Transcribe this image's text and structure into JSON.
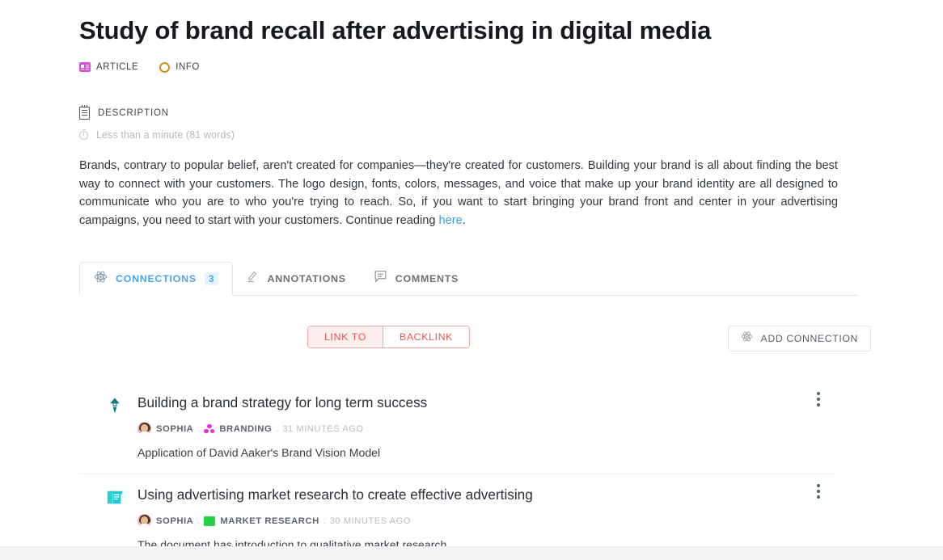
{
  "document": {
    "title": "Study of brand recall after advertising in digital media",
    "badges": [
      {
        "label": "ARTICLE",
        "icon": "article-icon",
        "color": "#d94fd9"
      },
      {
        "label": "INFO",
        "icon": "info-circle-icon",
        "color": "#c8920f"
      }
    ]
  },
  "description": {
    "heading": "DESCRIPTION",
    "heading_icon": "notepad-icon",
    "meta_icon": "clock-icon",
    "meta": "Less than a minute (81 words)",
    "body_before_link": "Brands, contrary to popular belief, aren't created for companies—they're created for customers. Building your brand is all about finding the best way to connect with your customers. The logo design, fonts, colors, messages, and voice that make up your brand identity are all designed to communicate who you are to who you're trying to reach. So, if you want to start bringing your brand front and center in your advertising campaigns, you need to start with your customers. Continue reading ",
    "link_text": "here",
    "body_after_link": "."
  },
  "tabs": [
    {
      "label": "CONNECTIONS",
      "icon": "network-icon",
      "badge": "3",
      "active": true
    },
    {
      "label": "ANNOTATIONS",
      "icon": "pencil-icon",
      "badge": "",
      "active": false
    },
    {
      "label": "COMMENTS",
      "icon": "comment-bubble-icon",
      "badge": "",
      "active": false
    }
  ],
  "actions": {
    "toggle": [
      {
        "label": "LINK TO",
        "selected": true
      },
      {
        "label": "BACKLINK",
        "selected": false
      }
    ],
    "add_connection": {
      "label": "ADD CONNECTION",
      "icon": "network-icon"
    },
    "accent_color": "#e8564f"
  },
  "connections": [
    {
      "icon": "pen-nib-icon",
      "icon_color": "#0e7b7b",
      "title": "Building a brand strategy for long term success",
      "author": "SOPHIA",
      "separator": ".",
      "tag": "BRANDING",
      "tag_icon": "cluster-dots-icon",
      "tag_color": "#e830d4",
      "time": "31 MINUTES AGO",
      "subtitle": "Application of David Aaker's Brand Vision Model",
      "menu_icon": "kebab-menu-icon"
    },
    {
      "icon": "document-folder-icon",
      "icon_color": "#2ad0d0",
      "title": "Using advertising market research to create effective advertising",
      "author": "SOPHIA",
      "separator": ".",
      "tag": "MARKET RESEARCH",
      "tag_icon": "green-square-icon",
      "tag_color": "#25d045",
      "time": "30 MINUTES AGO",
      "subtitle": "The document has introduction to qualitative market research.",
      "menu_icon": "kebab-menu-icon"
    }
  ]
}
